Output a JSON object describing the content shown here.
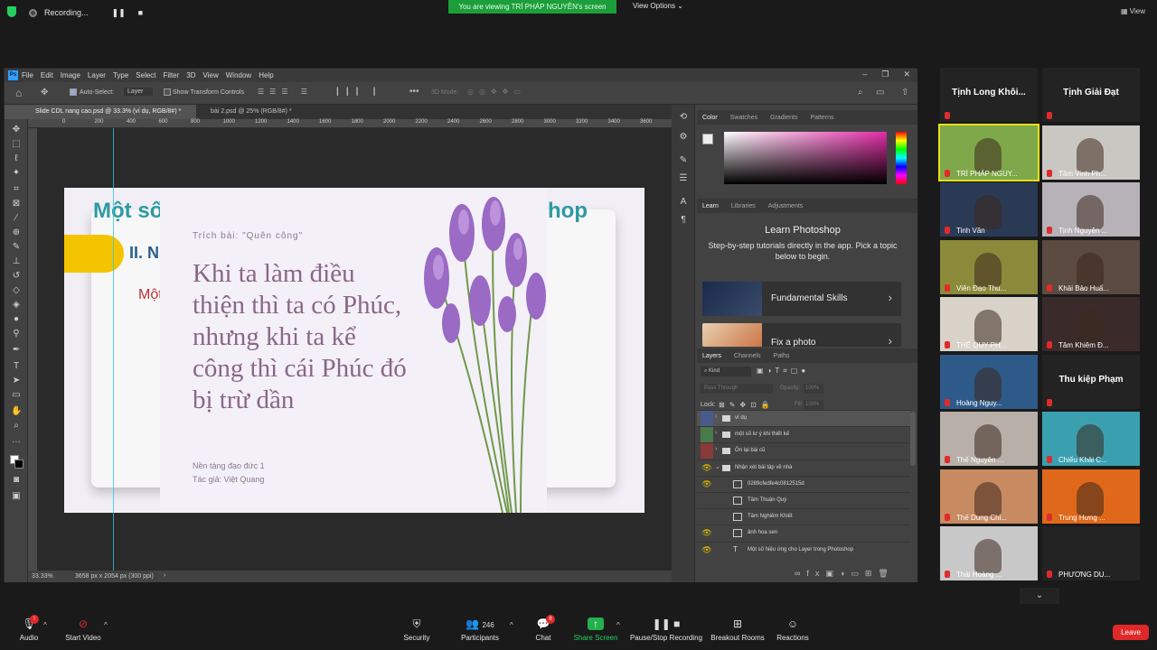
{
  "zoom": {
    "recording_label": "Recording...",
    "viewing_banner": "You are viewing TRÍ PHÁP NGUYỄN's screen",
    "view_options": "View Options",
    "view_right": "View",
    "leave": "Leave",
    "bottom": {
      "audio": "Audio",
      "start_video": "Start Video",
      "security": "Security",
      "participants": "Participants",
      "participants_count": "246",
      "chat": "Chat",
      "chat_badge": "8",
      "share_screen": "Share Screen",
      "pause_stop": "Pause/Stop Recording",
      "breakout": "Breakout Rooms",
      "reactions": "Reactions"
    },
    "gallery": [
      {
        "name": "Tịnh Long Khôi...",
        "video": false,
        "color": "#232323"
      },
      {
        "name": "Tịnh Giải Đạt",
        "video": false,
        "color": "#232323"
      },
      {
        "name": "TRÍ PHÁP NGUY...",
        "video": true,
        "color": "#7fa84a",
        "active": true
      },
      {
        "name": "Tâm Vinh Ph...",
        "video": true,
        "color": "#c9c7c2"
      },
      {
        "name": "Tinh Vân",
        "video": true,
        "color": "#2a3a55"
      },
      {
        "name": "Tịnh Nguyên ...",
        "video": true,
        "color": "#b7b2b8"
      },
      {
        "name": "Viên Đạo Thu...",
        "video": true,
        "color": "#8a8a3a"
      },
      {
        "name": "Khải Bảo Huấ...",
        "video": true,
        "color": "#5a4a40"
      },
      {
        "name": "THẾ QUY PH...",
        "video": true,
        "color": "#d8d2c8"
      },
      {
        "name": "Tâm Khiêm Đ...",
        "video": true,
        "color": "#3a2a2a"
      },
      {
        "name": "Hoàng Nguy...",
        "video": true,
        "color": "#2e5a8a"
      },
      {
        "name": "Thu kiệp Phạm",
        "video": false,
        "color": "#232323"
      },
      {
        "name": "Thế Nguyên ...",
        "video": true,
        "color": "#b8b0a8"
      },
      {
        "name": "Chiếu Khải C...",
        "video": true,
        "color": "#3aa0b0"
      },
      {
        "name": "Thế Dung Chi...",
        "video": true,
        "color": "#c88a60"
      },
      {
        "name": "Trung Hưng ...",
        "video": true,
        "color": "#e0681a"
      },
      {
        "name": "Thái Hoàng ...",
        "video": true,
        "color": "#c8c8c8"
      },
      {
        "name": "PHƯƠNG DU...",
        "video": false,
        "color": "#232323"
      }
    ]
  },
  "ps": {
    "menu": [
      "File",
      "Edit",
      "Image",
      "Layer",
      "Type",
      "Select",
      "Filter",
      "3D",
      "View",
      "Window",
      "Help"
    ],
    "options": {
      "auto_select": "Auto-Select:",
      "layer_dropdown": "Layer",
      "show_transform": "Show Transform Controls",
      "three_d_mode": "3D Mode:"
    },
    "tabs": [
      {
        "label": "Slide CDL nang cao.psd @ 33.3% (ví dụ, RGB/8#) *",
        "active": true
      },
      {
        "label": "bài 2.psd @ 25% (RGB/8#) *",
        "active": false
      }
    ],
    "ruler_ticks": [
      "0",
      "200",
      "400",
      "600",
      "800",
      "1000",
      "1200",
      "1400",
      "1600",
      "1800",
      "2000",
      "2200",
      "2400",
      "2600",
      "2800",
      "3000",
      "3200",
      "3400",
      "3600"
    ],
    "status": {
      "zoom": "33.33%",
      "doc_info": "3658 px x 2054 px (300 ppi)"
    },
    "doc": {
      "title_left": "Một số",
      "title_right": "hop",
      "subtitle": "II. N",
      "red_text": "Một",
      "quote_source": "Trích bài: \"Quên công\"",
      "quote": "Khi ta làm điều thiện thì ta có Phúc, nhưng khi ta kể công thì cái Phúc đó bị trừ dần",
      "footer1": "Nền tảng đạo đức 1",
      "footer2": "Tác giả: Việt Quang"
    },
    "panels": {
      "color_tabs": [
        "Color",
        "Swatches",
        "Gradients",
        "Patterns"
      ],
      "learn_tabs": [
        "Learn",
        "Libraries",
        "Adjustments"
      ],
      "learn_title": "Learn Photoshop",
      "learn_desc": "Step-by-step tutorials directly in the app. Pick a topic below to begin.",
      "learn_cards": [
        "Fundamental Skills",
        "Fix a photo"
      ],
      "layers_tabs": [
        "Layers",
        "Channels",
        "Paths"
      ],
      "kind": "Kind",
      "blend": "Pass Through",
      "opacity": "Opacity:",
      "opacity_val": "100%",
      "lock": "Lock:",
      "fill": "Fill:",
      "fill_val": "100%",
      "layers": [
        {
          "name": "ví dụ",
          "type": "folder",
          "eye": false,
          "color": "#4a5a8a"
        },
        {
          "name": "một số lư ý khi thiết kế",
          "type": "folder",
          "eye": false,
          "color": "#4a7a4a"
        },
        {
          "name": "Ôn lại bài cũ",
          "type": "folder",
          "eye": false,
          "color": "#8a3a3a"
        },
        {
          "name": "Nhận xét bài tập về nhà",
          "type": "folder",
          "eye": true,
          "color": "#424242"
        },
        {
          "name": "0289cfedfe4c0812515d",
          "type": "smart",
          "eye": true,
          "color": "#424242"
        },
        {
          "name": "Tâm Thuận Quý",
          "type": "smart",
          "eye": false,
          "color": "#424242"
        },
        {
          "name": "Tâm Nghiêm Khiết",
          "type": "smart",
          "eye": false,
          "color": "#424242"
        },
        {
          "name": "ảnh hoa sen",
          "type": "smart",
          "eye": true,
          "color": "#424242"
        },
        {
          "name": "Một số hiệu ứng cho Layer trong Photoshop",
          "type": "text",
          "eye": true,
          "color": "#424242"
        }
      ]
    }
  }
}
